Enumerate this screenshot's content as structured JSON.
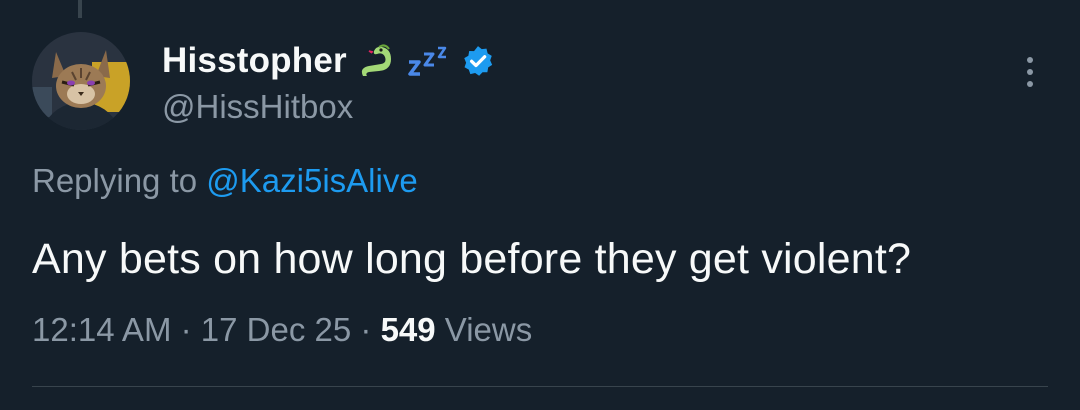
{
  "tweet": {
    "author": {
      "display_name": "Hisstopher",
      "name_emojis": [
        "snake-icon",
        "zzz-icon"
      ],
      "verified": true,
      "handle": "@HissHitbox"
    },
    "replying_prefix": "Replying to",
    "replying_to": "@Kazi5isAlive",
    "text": "Any bets on how long before they get violent?",
    "time": "12:14 AM",
    "separator": "·",
    "date": "17 Dec 25",
    "views_count": "549",
    "views_label": "Views"
  },
  "colors": {
    "background": "#15202b",
    "text_primary": "#f7f9f9",
    "text_secondary": "#8b98a5",
    "accent": "#1d9bf0",
    "divider": "#38444d"
  }
}
